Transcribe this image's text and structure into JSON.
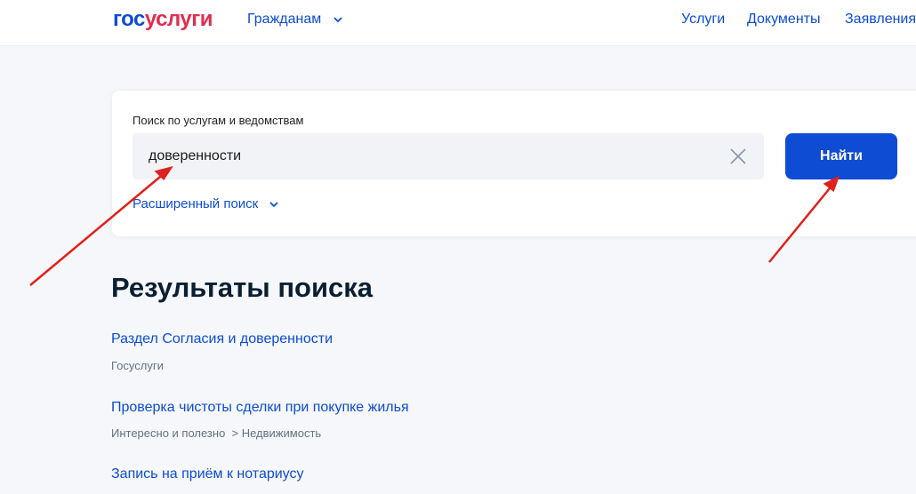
{
  "header": {
    "logo_part1": "гос",
    "logo_part2": "услуги",
    "citizens": "Гражданам",
    "nav": [
      "Услуги",
      "Документы",
      "Заявления"
    ]
  },
  "search": {
    "label": "Поиск по услугам и ведомствам",
    "value": "доверенности",
    "button": "Найти",
    "advanced": "Расширенный поиск"
  },
  "results": {
    "title": "Результаты поиска",
    "items": [
      {
        "title": "Раздел Согласия и доверенности",
        "source": "Госуслуги"
      },
      {
        "title": "Проверка чистоты сделки при покупке жилья",
        "source": "Интересно и полезно  > Недвижимость"
      },
      {
        "title": "Запись на приём к нотариусу"
      }
    ]
  },
  "colors": {
    "accent": "#0d4cd3",
    "logo_red": "#e12d4e",
    "arrow": "#e0201b"
  }
}
